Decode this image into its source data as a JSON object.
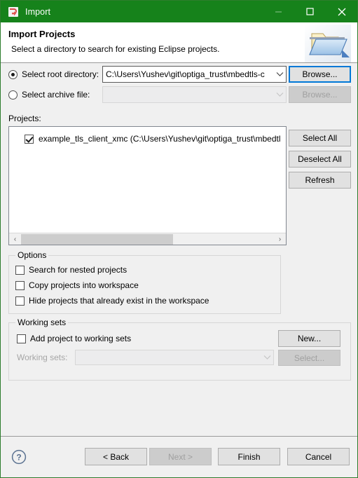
{
  "window": {
    "title": "Import",
    "icon": "import-wizard-icon",
    "accent_color": "#16821b",
    "minimize_label": "—",
    "maximize_label": "□",
    "close_label": "✕"
  },
  "header": {
    "title": "Import Projects",
    "subtitle": "Select a directory to search for existing Eclipse projects.",
    "icon": "open-folder-icon"
  },
  "source": {
    "root_directory": {
      "radio_label": "Select root directory:",
      "selected": true,
      "value": "C:\\Users\\Yushev\\git\\optiga_trust\\mbedtls-c",
      "browse_label": "Browse...",
      "browse_focused": true
    },
    "archive_file": {
      "radio_label": "Select archive file:",
      "selected": false,
      "value": "",
      "browse_label": "Browse...",
      "browse_disabled": true
    }
  },
  "projects": {
    "label": "Projects:",
    "items": [
      {
        "checked": true,
        "label": "example_tls_client_xmc (C:\\Users\\Yushev\\git\\optiga_trust\\mbedtl"
      }
    ],
    "buttons": {
      "select_all": "Select All",
      "deselect_all": "Deselect All",
      "refresh": "Refresh"
    },
    "scrollbar": {
      "left_arrow": "‹",
      "right_arrow": "›"
    }
  },
  "options": {
    "group_title": "Options",
    "items": [
      {
        "label": "Search for nested projects",
        "checked": false
      },
      {
        "label": "Copy projects into workspace",
        "checked": false
      },
      {
        "label": "Hide projects that already exist in the workspace",
        "checked": false
      }
    ]
  },
  "working_sets": {
    "group_title": "Working sets",
    "add_checkbox": {
      "label": "Add project to working sets",
      "checked": false
    },
    "new_button": "New...",
    "combo_label": "Working sets:",
    "combo_value": "",
    "combo_disabled": true,
    "select_button": "Select...",
    "select_disabled": true
  },
  "footer": {
    "help_icon": "help-question-icon",
    "back_label": "< Back",
    "next_label": "Next >",
    "next_disabled": true,
    "finish_label": "Finish",
    "cancel_label": "Cancel"
  }
}
